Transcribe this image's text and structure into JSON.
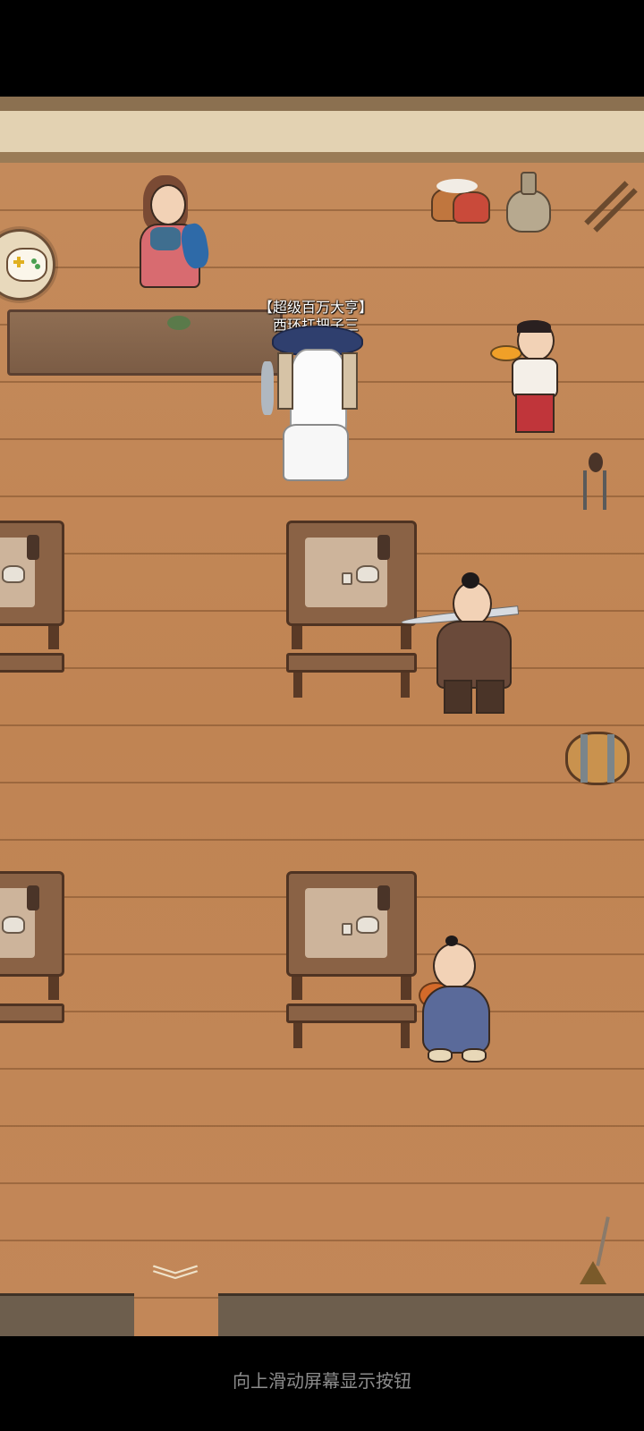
{
  "player": {
    "title": "【超级百万大亨】",
    "name": "西环扛把子三"
  },
  "system_hint": "向上滑动屏幕显示按钮",
  "icons": {
    "game_menu": "gamepad-icon",
    "scroll_down": "chevron-double-down-icon"
  }
}
